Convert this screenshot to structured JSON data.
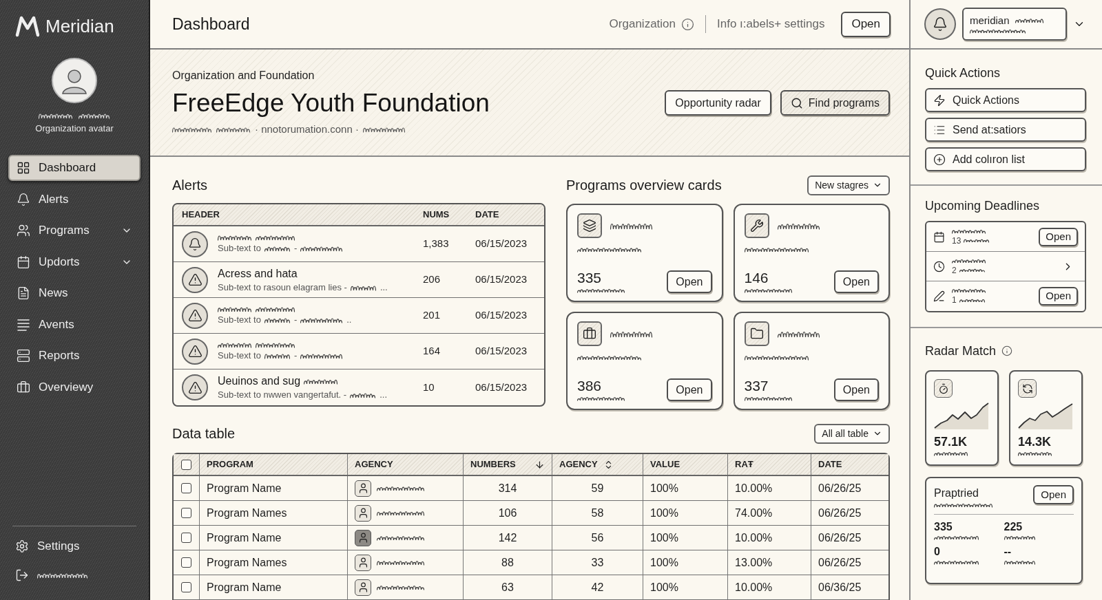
{
  "sidebar": {
    "brand": "Meridian",
    "avatar_caption": "Organization avatar",
    "items": [
      {
        "label": "Dashboard",
        "selected": true,
        "has_submenu": false
      },
      {
        "label": "Alerts",
        "selected": false,
        "has_submenu": false
      },
      {
        "label": "Programs",
        "selected": false,
        "has_submenu": true
      },
      {
        "label": "Updorts",
        "selected": false,
        "has_submenu": true
      },
      {
        "label": "News",
        "selected": false,
        "has_submenu": false
      },
      {
        "label": "Avents",
        "selected": false,
        "has_submenu": false
      },
      {
        "label": "Reports",
        "selected": false,
        "has_submenu": false
      },
      {
        "label": "Overviewy",
        "selected": false,
        "has_submenu": false
      }
    ],
    "settings_label": "Settings"
  },
  "topbar": {
    "title": "Dashboard",
    "links": [
      {
        "label": "Organization",
        "info": true
      },
      {
        "label": "Info ı:abels+ settings",
        "info": false
      }
    ],
    "button": "Open"
  },
  "hero": {
    "eyebrow": "Organization and Foundation",
    "title": "FreeEdge Youth Foundation",
    "website": "· nnotorumation.conn ·",
    "buttons": [
      {
        "label": "Opportunity radar",
        "kind": "plain",
        "primary": false
      },
      {
        "label": "Find programs",
        "kind": "search",
        "primary": true
      }
    ]
  },
  "alerts": {
    "title": "Alerts",
    "columns": [
      "HEADER",
      "NUMS",
      "DATE"
    ],
    "rows": [
      {
        "kind": "notice",
        "title": [
          {
            "kind": "scribble"
          },
          {
            "kind": "scribble"
          }
        ],
        "subtext": [
          {
            "kind": "text",
            "text": "Sub-text to"
          },
          {
            "kind": "scribble"
          },
          {
            "kind": "text",
            "text": "-"
          },
          {
            "kind": "scribble"
          }
        ],
        "nums": "1,383",
        "date": "06/15/2023"
      },
      {
        "kind": "warning",
        "title": [
          {
            "kind": "text",
            "text": "Acress and hata"
          }
        ],
        "subtext": [
          {
            "kind": "text",
            "text": "Sub-text to rasoun elagram lies -"
          },
          {
            "kind": "scribble"
          },
          {
            "kind": "text",
            "text": "..."
          }
        ],
        "nums": "206",
        "date": "06/15/2023"
      },
      {
        "kind": "warning",
        "title": [
          {
            "kind": "scribble"
          },
          {
            "kind": "scribble"
          }
        ],
        "subtext": [
          {
            "kind": "text",
            "text": "Sub-text to"
          },
          {
            "kind": "scribble"
          },
          {
            "kind": "text",
            "text": "-"
          },
          {
            "kind": "scribble"
          },
          {
            "kind": "text",
            "text": ".."
          }
        ],
        "nums": "201",
        "date": "06/15/2023"
      },
      {
        "kind": "warning",
        "title": [
          {
            "kind": "scribble"
          },
          {
            "kind": "scribble"
          }
        ],
        "subtext": [
          {
            "kind": "text",
            "text": "Sub-text to"
          },
          {
            "kind": "scribble"
          },
          {
            "kind": "text",
            "text": "-"
          },
          {
            "kind": "scribble"
          }
        ],
        "nums": "164",
        "date": "06/15/2023"
      },
      {
        "kind": "warning",
        "title": [
          {
            "kind": "text",
            "text": "Ueuinos and sug"
          },
          {
            "kind": "scribble"
          }
        ],
        "subtext": [
          {
            "kind": "text",
            "text": "Sub-text to nwwen vangertafut. -"
          },
          {
            "kind": "scribble"
          },
          {
            "kind": "text",
            "text": "..."
          }
        ],
        "nums": "10",
        "date": "06/15/2023"
      }
    ]
  },
  "programs": {
    "title": "Programs overview cards",
    "filter": "New stagres",
    "cards": [
      {
        "value": "335",
        "button": "Open"
      },
      {
        "value": "146",
        "button": "Open"
      },
      {
        "value": "386",
        "button": "Open"
      },
      {
        "value": "337",
        "button": "Open"
      }
    ]
  },
  "data_table": {
    "title": "Data table",
    "filter": "All all table",
    "select_all": {
      "checked": false
    },
    "columns": [
      {
        "label": "PROGRAM",
        "kind": "plain"
      },
      {
        "label": "AGENCY",
        "kind": "plain"
      },
      {
        "label": "NUMBERS",
        "kind": "sorted_desc"
      },
      {
        "label": "AGENCY",
        "kind": "sortable"
      },
      {
        "label": "VALUE",
        "kind": "plain"
      },
      {
        "label": "RAŦ",
        "kind": "plain"
      },
      {
        "label": "DATE",
        "kind": "plain"
      }
    ],
    "rows": [
      {
        "checked": false,
        "program": "Program Name",
        "avatar_filled": false,
        "numbers": "314",
        "agency": "59",
        "value": "100%",
        "rate": "10.00%",
        "date": "06/26/25"
      },
      {
        "checked": false,
        "program": "Program Names",
        "avatar_filled": false,
        "numbers": "106",
        "agency": "58",
        "value": "100%",
        "rate": "74.00%",
        "date": "06/26/25"
      },
      {
        "checked": false,
        "program": "Program Name",
        "avatar_filled": true,
        "numbers": "142",
        "agency": "56",
        "value": "100%",
        "rate": "10.00%",
        "date": "06/26/25"
      },
      {
        "checked": false,
        "program": "Program Names",
        "avatar_filled": false,
        "numbers": "88",
        "agency": "33",
        "value": "100%",
        "rate": "13.00%",
        "date": "06/26/25"
      },
      {
        "checked": false,
        "program": "Program Name",
        "avatar_filled": false,
        "numbers": "63",
        "agency": "42",
        "value": "100%",
        "rate": "10.00%",
        "date": "06/36/25"
      }
    ]
  },
  "account": {
    "name": "meridian"
  },
  "quick_actions": {
    "title": "Quick Actions",
    "items": [
      "Quick Actions",
      "Send at:satiors",
      "Add colıron list"
    ]
  },
  "deadlines": {
    "title": "Upcoming Deadlines",
    "items": [
      {
        "count": "13",
        "action": {
          "kind": "button",
          "label": "Open"
        }
      },
      {
        "count": "2",
        "action": {
          "kind": "chevron"
        }
      },
      {
        "count": "1",
        "action": {
          "kind": "button",
          "label": "Open"
        }
      }
    ]
  },
  "radar": {
    "title": "Radar Match",
    "cards": [
      {
        "value": "57.1K"
      },
      {
        "value": "14.3K"
      }
    ],
    "summary": {
      "title": "Praptried",
      "button": "Open",
      "stats": [
        {
          "value": "335"
        },
        {
          "value": "225"
        },
        {
          "value": "0"
        },
        {
          "value": "--"
        }
      ]
    }
  }
}
